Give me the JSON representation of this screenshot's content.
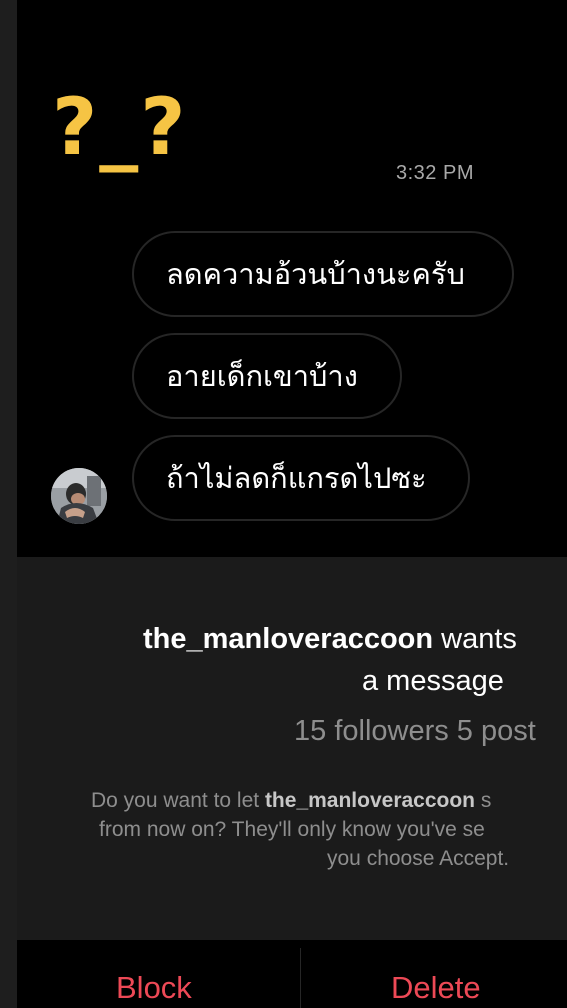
{
  "overlay": {
    "text": "?_?"
  },
  "thread": {
    "timestamp": "3:32 PM",
    "messages": [
      "ลดความอ้วนบ้างนะครับ",
      "อายเด็กเขาบ้าง",
      "ถ้าไม่ลดก็แกรดไปซะ"
    ]
  },
  "request": {
    "username": "the_manloveraccoon",
    "title_suffix": " wants",
    "title_line2": "a message",
    "stats": "15 followers 5 post",
    "desc_prefix": "Do you want to let ",
    "desc_username": "the_manloveraccoon",
    "desc_suffix": " s",
    "desc_line2": "from now on? They'll only know you've se",
    "desc_line3": "you choose Accept."
  },
  "actions": {
    "block_label": "Block",
    "delete_label": "Delete"
  },
  "colors": {
    "overlay": "#f6c444",
    "destructive": "#ed4956",
    "panel_bg": "#1b1b1b",
    "bubble_border": "#262626"
  }
}
